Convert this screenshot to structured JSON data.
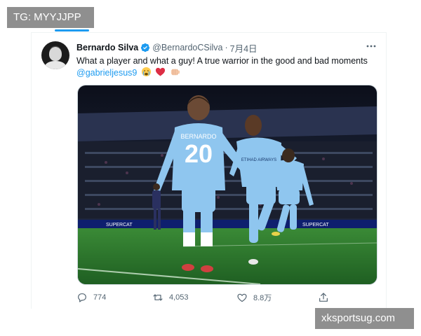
{
  "watermark_top": "TG: MYYJJPP",
  "watermark_bottom": "xksportsug.com",
  "tweet": {
    "author_name": "Bernardo Silva",
    "handle": "@BernardoCSilva",
    "separator": "·",
    "date": "7月4日",
    "text": "What a player and what a guy! A true warrior in the good and bad moments",
    "mention": "@gabrieljesus9",
    "emojis": [
      "crying-face",
      "red-heart",
      "fist-bump"
    ],
    "media": {
      "shirt_number": "20",
      "shirt_name": "BERNARDO",
      "sponsor": "ETIHAD AIRWAYS",
      "board_text": "SUPERCAT",
      "colors": {
        "kit": "#8fc6ef",
        "pitch": "#2f7a2d",
        "stands": "#141826"
      }
    },
    "actions": {
      "replies": "774",
      "retweets": "4,053",
      "likes": "8.8万"
    }
  },
  "colors": {
    "accent": "#1d9bf0",
    "secondary_text": "#536471"
  }
}
